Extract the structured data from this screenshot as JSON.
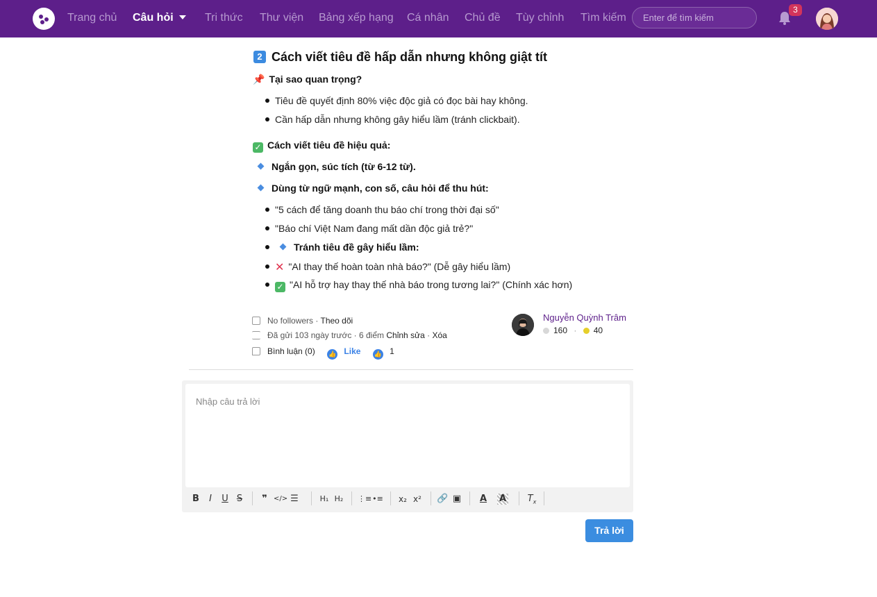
{
  "nav": {
    "items": [
      {
        "label": "Trang chủ"
      },
      {
        "label": "Câu hỏi"
      },
      {
        "label": "Tri thức"
      },
      {
        "label": "Thư viện"
      },
      {
        "label": "Bảng xếp hạng"
      },
      {
        "label": "Cá nhân"
      },
      {
        "label": "Chủ đề"
      },
      {
        "label": "Tùy chỉnh"
      },
      {
        "label": "Tìm kiếm"
      }
    ],
    "active_index": 1,
    "search_placeholder": "Enter để tìm kiếm",
    "notification_count": "3",
    "accent_color": "#5d1f8a"
  },
  "post": {
    "section_number": "2",
    "section_title": "Cách viết tiêu đề hấp dẫn nhưng không giật tít",
    "why_heading": "Tại sao quan trọng?",
    "why_items": [
      "Tiêu đề quyết định 80% việc độc giả có đọc bài hay không.",
      "Cần hấp dẫn nhưng không gây hiểu lầm (tránh clickbait)."
    ],
    "how_heading": "Cách viết tiêu đề hiệu quả:",
    "tips": [
      "Ngắn gọn, súc tích (từ 6-12 từ).",
      "Dùng từ ngữ mạnh, con số, câu hỏi để thu hút:"
    ],
    "examples": [
      "\"5 cách để tăng doanh thu báo chí trong thời đại số\"",
      "\"Báo chí Việt Nam đang mất dần độc giả trẻ?\""
    ],
    "avoid_heading": "Tránh tiêu đề gây hiểu lầm:",
    "bad_example": "\"AI thay thế hoàn toàn nhà báo?\" (Dễ gây hiểu lầm)",
    "good_example": "\"AI hỗ trợ hay thay thế nhà báo trong tương lai?\" (Chính xác hơn)"
  },
  "meta": {
    "followers": "No followers",
    "follow_label": "Theo dõi",
    "sent": "Đã gửi 103 ngày trước",
    "points": "6 điểm",
    "edit_label": "Chỉnh sửa",
    "delete_label": "Xóa",
    "comment_label": "Bình luận (0)",
    "like_label": "Like",
    "like_count": "1"
  },
  "author": {
    "name": "Nguyễn Quỳnh Trâm",
    "score_silver": "160",
    "score_gold": "40"
  },
  "editor": {
    "placeholder": "Nhập câu trả lời",
    "reply_label": "Trả lời"
  },
  "toolbar": {
    "icons": [
      "bold-icon",
      "italic-icon",
      "underline-icon",
      "strike-icon",
      "quote-icon",
      "code-icon",
      "align-icon",
      "h1-icon",
      "h2-icon",
      "ordered-list-icon",
      "bullet-list-icon",
      "subscript-icon",
      "superscript-icon",
      "link-icon",
      "image-icon",
      "font-color-icon",
      "background-color-icon",
      "clear-format-icon"
    ]
  }
}
